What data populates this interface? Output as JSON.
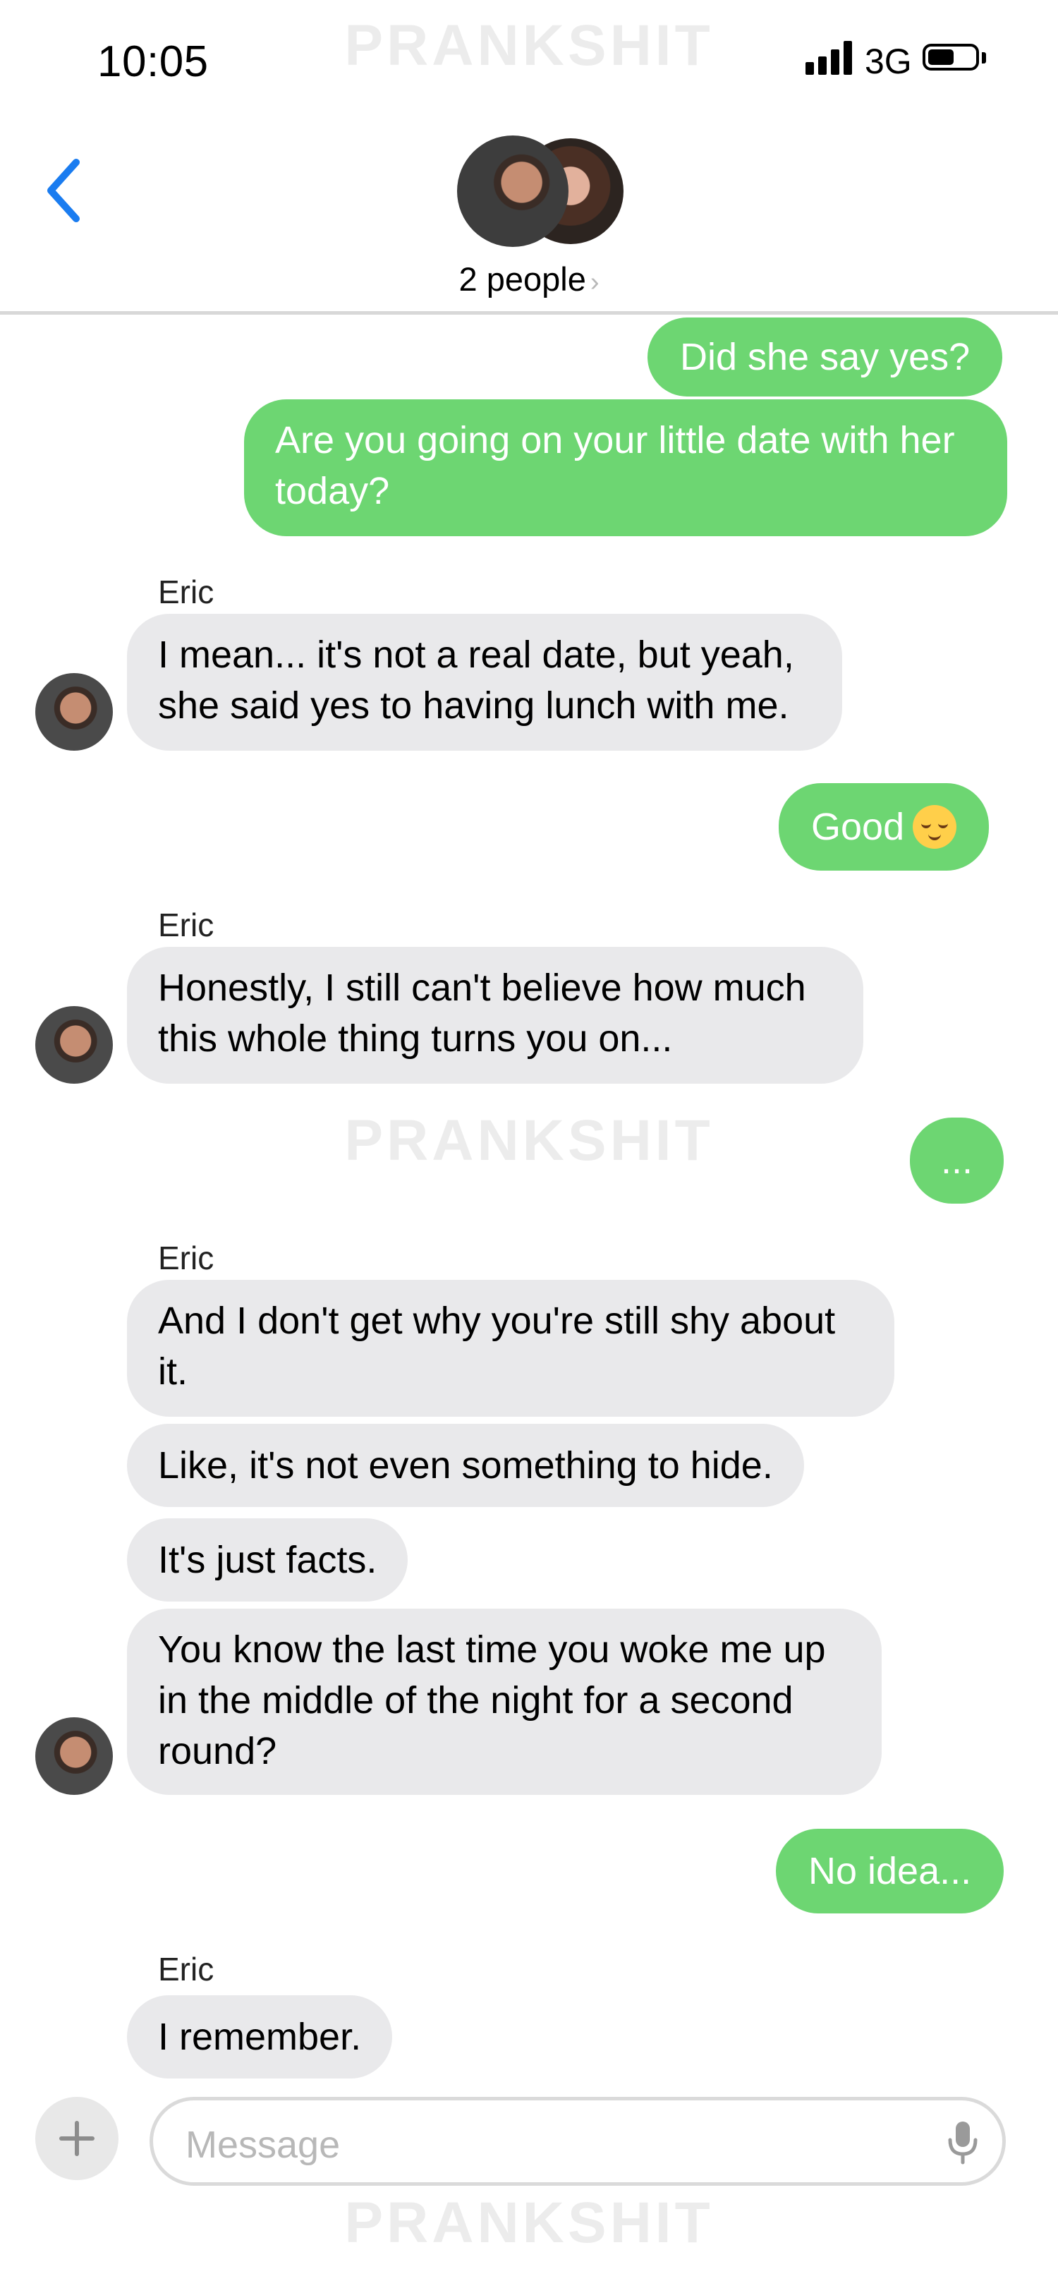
{
  "status_bar": {
    "time": "10:05",
    "network": "3G"
  },
  "watermark": "PRANKSHIT",
  "header": {
    "participants_label": "2 people"
  },
  "messages": [
    {
      "direction": "out",
      "text": "Did she say yes?"
    },
    {
      "direction": "out",
      "text": "Are you going on your little date with her today?"
    },
    {
      "direction": "in",
      "sender": "Eric",
      "text": "I mean... it's not a real date, but yeah, she said yes to having lunch with me."
    },
    {
      "direction": "out",
      "text": "Good"
    },
    {
      "direction": "in",
      "sender": "Eric",
      "text": "Honestly, I still can't believe how much this whole thing turns you on..."
    },
    {
      "direction": "out",
      "text": "..."
    },
    {
      "direction": "in",
      "sender": "Eric",
      "text": "And I don't get why you're still shy about it."
    },
    {
      "direction": "in",
      "text": "Like, it's not even something to hide."
    },
    {
      "direction": "in",
      "text": "It's just facts."
    },
    {
      "direction": "in",
      "text": "You know the last time you woke me up in the middle of the night for a second round?"
    },
    {
      "direction": "out",
      "text": "No idea..."
    },
    {
      "direction": "in",
      "sender": "Eric",
      "text": "I remember."
    }
  ],
  "composer": {
    "placeholder": "Message"
  },
  "icons": {
    "back": "chevron-left-icon",
    "add": "plus-icon",
    "mic": "microphone-icon",
    "emoji": "relieved-face-emoji",
    "signal": "signal-icon",
    "battery": "battery-icon"
  },
  "colors": {
    "outgoing_bubble": "#6dd672",
    "incoming_bubble": "#e9e9eb",
    "accent": "#1a7cf0"
  }
}
